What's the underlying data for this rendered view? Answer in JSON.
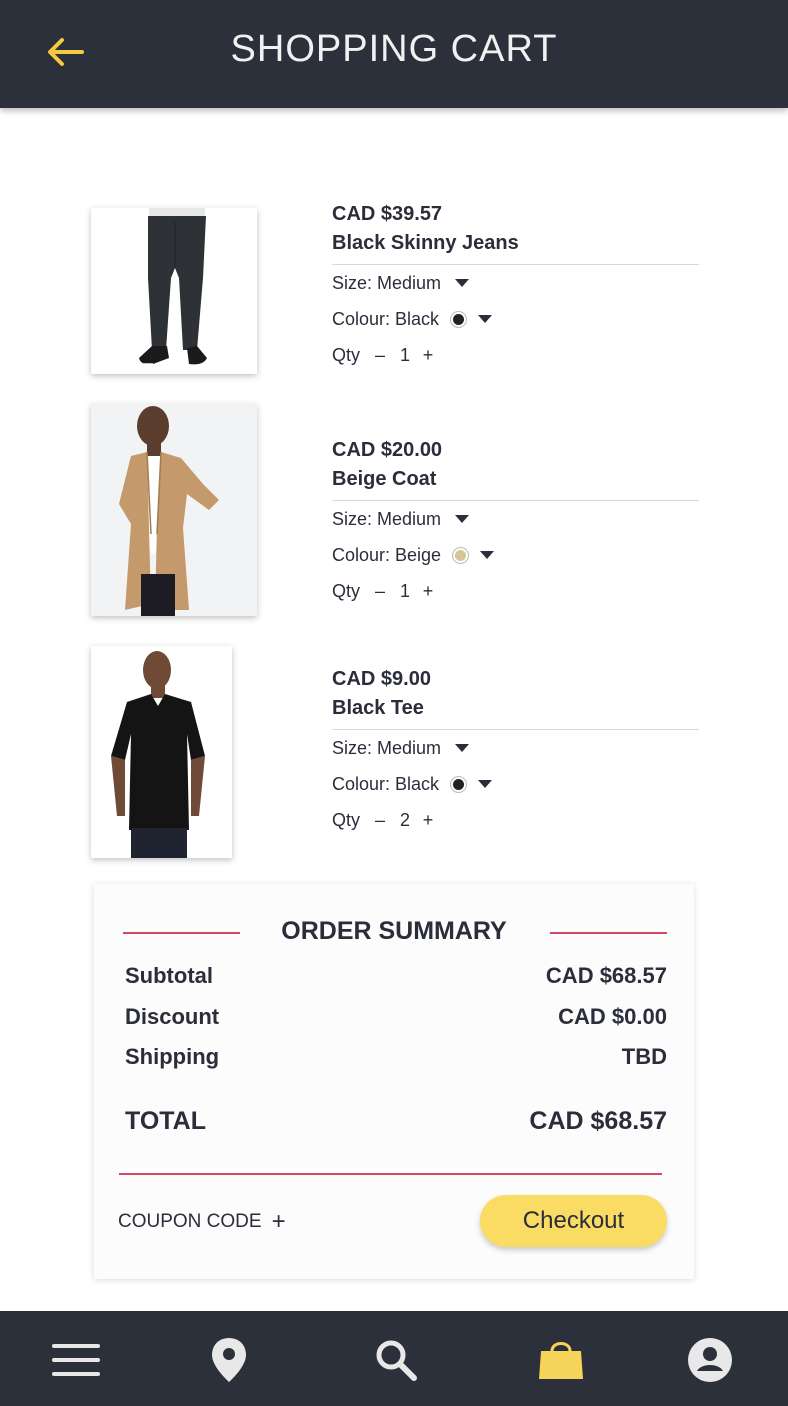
{
  "header": {
    "title": "SHOPPING CART"
  },
  "colors": {
    "accent": "#fadb63",
    "dark": "#2c303b",
    "divider": "#d04a62"
  },
  "items": [
    {
      "price": "CAD $39.57",
      "name": "Black Skinny Jeans",
      "size_label": "Size: Medium",
      "colour_label": "Colour: Black",
      "swatch": "#222222",
      "qty_label": "Qty",
      "qty_minus": "–",
      "qty": "1",
      "qty_plus": "+"
    },
    {
      "price": "CAD $20.00",
      "name": "Beige Coat",
      "size_label": "Size: Medium",
      "colour_label": "Colour: Beige",
      "swatch": "#d8c596",
      "qty_label": "Qty",
      "qty_minus": "–",
      "qty": "1",
      "qty_plus": "+"
    },
    {
      "price": "CAD $9.00",
      "name": "Black Tee",
      "size_label": "Size: Medium",
      "colour_label": "Colour: Black",
      "swatch": "#222222",
      "qty_label": "Qty",
      "qty_minus": "–",
      "qty": "2",
      "qty_plus": "+"
    }
  ],
  "summary": {
    "title": "ORDER SUMMARY",
    "subtotal_label": "Subtotal",
    "subtotal_value": "CAD $68.57",
    "discount_label": "Discount",
    "discount_value": "CAD $0.00",
    "shipping_label": "Shipping",
    "shipping_value": "TBD",
    "total_label": "TOTAL",
    "total_value": "CAD $68.57",
    "coupon_label": "COUPON CODE",
    "coupon_plus": "+",
    "checkout_label": "Checkout"
  },
  "nav": [
    "menu-icon",
    "location-pin-icon",
    "search-icon",
    "shopping-bag-icon",
    "account-icon"
  ]
}
